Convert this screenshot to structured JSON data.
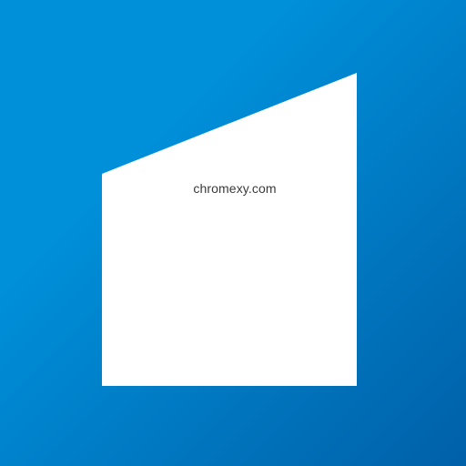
{
  "icon": {
    "colors": {
      "gradient_start": "#0090da",
      "gradient_end": "#0060a8",
      "shape": "#ffffff"
    },
    "shape_icon": "slanted-roof-building-icon"
  },
  "watermark": {
    "text": "chromexy.com",
    "color": "#3a3a3a"
  }
}
